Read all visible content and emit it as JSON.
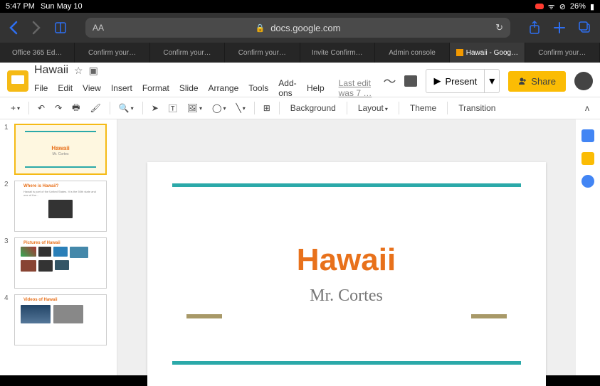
{
  "ios": {
    "time": "5:47 PM",
    "date": "Sun May 10",
    "battery": "26%"
  },
  "safari": {
    "url": "docs.google.com"
  },
  "tabs": [
    {
      "label": "Office 365 Ed…"
    },
    {
      "label": "Confirm your…"
    },
    {
      "label": "Confirm your…"
    },
    {
      "label": "Confirm your…"
    },
    {
      "label": "Invite Confirm…"
    },
    {
      "label": "Admin console"
    },
    {
      "label": "Hawaii - Goog…",
      "active": true
    },
    {
      "label": "Confirm your…"
    }
  ],
  "doc": {
    "name": "Hawaii",
    "last_edit": "Last edit was 7 …"
  },
  "menubar": [
    "File",
    "Edit",
    "View",
    "Insert",
    "Format",
    "Slide",
    "Arrange",
    "Tools",
    "Add-ons",
    "Help"
  ],
  "buttons": {
    "present": "Present",
    "share": "Share"
  },
  "toolbar": {
    "background": "Background",
    "layout": "Layout",
    "theme": "Theme",
    "transition": "Transition"
  },
  "slide": {
    "title": "Hawaii",
    "subtitle": "Mr. Cortes"
  },
  "thumbs": [
    {
      "title": "Hawaii",
      "sub": "Mr. Cortes"
    },
    {
      "title": "Where is Hawaii?"
    },
    {
      "title": "Pictures of Hawaii"
    },
    {
      "title": "Videos of Hawaii"
    }
  ]
}
